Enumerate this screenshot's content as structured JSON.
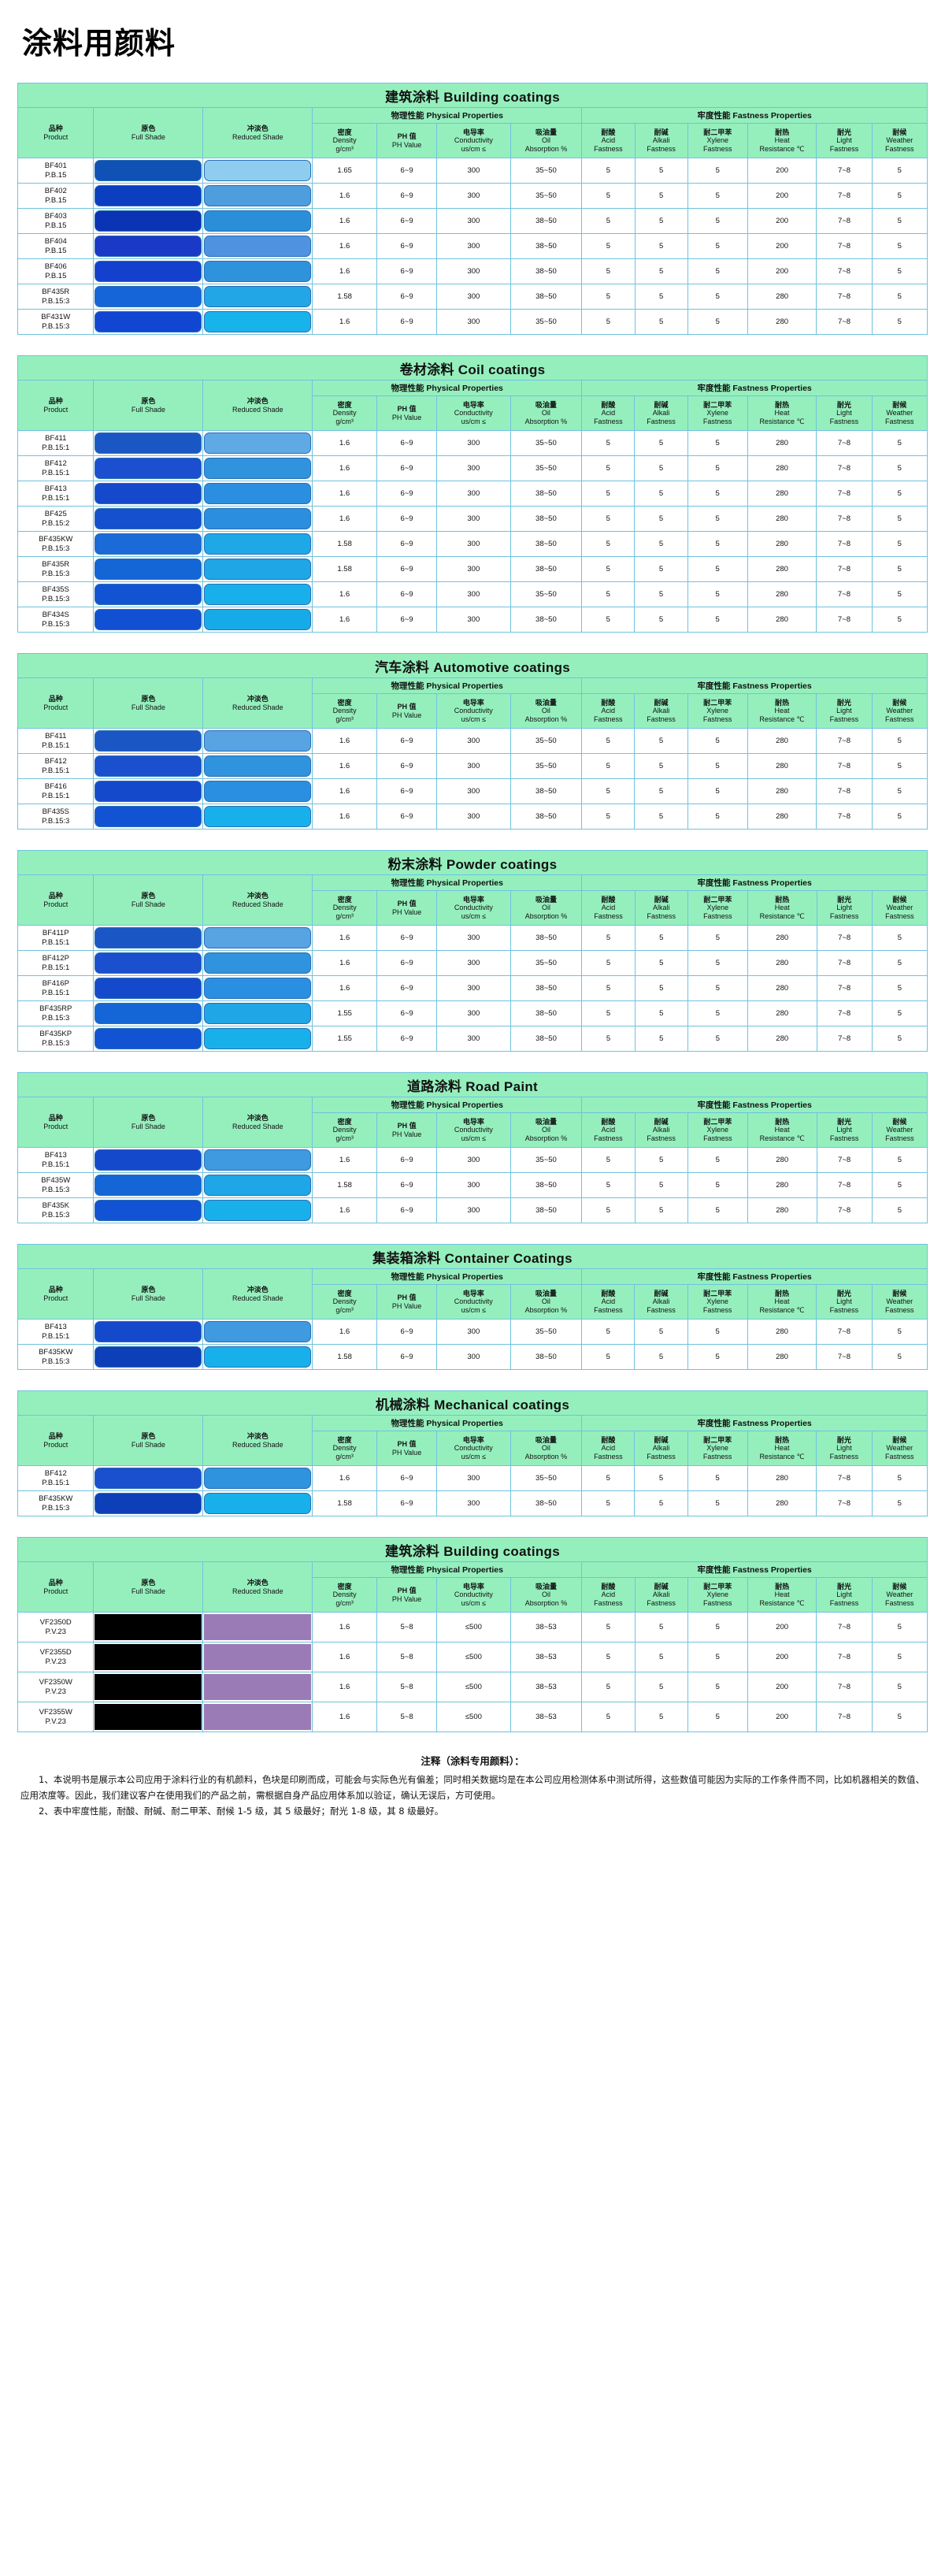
{
  "document": {
    "title": "涂料用颜料"
  },
  "columns": {
    "product": {
      "cn": "品种",
      "en": "Product"
    },
    "full_shade": {
      "cn": "原色",
      "en": "Full Shade"
    },
    "reduced_shade": {
      "cn": "冲淡色",
      "en": "Reduced Shade"
    },
    "physical_group": "物理性能 Physical Properties",
    "fastness_group": "牢度性能 Fastness Properties",
    "density": {
      "cn": "密度",
      "en": "Density",
      "unit": "g/cm³"
    },
    "ph": {
      "cn": "PH 值",
      "en": "PH Value"
    },
    "conductivity": {
      "cn": "电导率",
      "en": "Conductivity",
      "unit": "us/cm ≤"
    },
    "oil": {
      "cn": "吸油量",
      "en": "Oil",
      "unit": "Absorption %"
    },
    "acid": {
      "cn": "耐酸",
      "en": "Acid",
      "unit": "Fastness"
    },
    "alkali": {
      "cn": "耐碱",
      "en": "Alkali",
      "unit": "Fastness"
    },
    "xylene": {
      "cn": "耐二甲苯",
      "en": "Xylene",
      "unit": "Fastness"
    },
    "heat": {
      "cn": "耐热",
      "en": "Heat",
      "unit": "Resistance ℃"
    },
    "light": {
      "cn": "耐光",
      "en": "Light",
      "unit": "Fastness"
    },
    "weather": {
      "cn": "耐候",
      "en": "Weather",
      "unit": "Fastness"
    }
  },
  "colors": {
    "band": "#95efbd",
    "border": "#6fc2de",
    "outer_border": "#4aa8cf"
  },
  "tables": [
    {
      "title": "建筑涂料 Building coatings",
      "swatch_style": "round",
      "rows": [
        {
          "code": "BF401",
          "index": "P.B.15",
          "full": "#0f51b5",
          "reduced": "#8fcdf0",
          "density": "1.65",
          "ph": "6~9",
          "conductivity": "300",
          "oil": "35~50",
          "acid": "5",
          "alkali": "5",
          "xylene": "5",
          "heat": "200",
          "light": "7~8",
          "weather": "5"
        },
        {
          "code": "BF402",
          "index": "P.B.15",
          "full": "#0b3fc0",
          "reduced": "#4e9ddd",
          "density": "1.6",
          "ph": "6~9",
          "conductivity": "300",
          "oil": "35~50",
          "acid": "5",
          "alkali": "5",
          "xylene": "5",
          "heat": "200",
          "light": "7~8",
          "weather": "5"
        },
        {
          "code": "BF403",
          "index": "P.B.15",
          "full": "#0a34b4",
          "reduced": "#2a8fd8",
          "density": "1.6",
          "ph": "6~9",
          "conductivity": "300",
          "oil": "38~50",
          "acid": "5",
          "alkali": "5",
          "xylene": "5",
          "heat": "200",
          "light": "7~8",
          "weather": "5"
        },
        {
          "code": "BF404",
          "index": "P.B.15",
          "full": "#1939c6",
          "reduced": "#4f92e0",
          "density": "1.6",
          "ph": "6~9",
          "conductivity": "300",
          "oil": "38~50",
          "acid": "5",
          "alkali": "5",
          "xylene": "5",
          "heat": "200",
          "light": "7~8",
          "weather": "5"
        },
        {
          "code": "BF406",
          "index": "P.B.15",
          "full": "#1340cc",
          "reduced": "#2f92dd",
          "density": "1.6",
          "ph": "6~9",
          "conductivity": "300",
          "oil": "38~50",
          "acid": "5",
          "alkali": "5",
          "xylene": "5",
          "heat": "200",
          "light": "7~8",
          "weather": "5"
        },
        {
          "code": "BF435R",
          "index": "P.B.15:3",
          "full": "#1565d8",
          "reduced": "#22a6e6",
          "density": "1.58",
          "ph": "6~9",
          "conductivity": "300",
          "oil": "38~50",
          "acid": "5",
          "alkali": "5",
          "xylene": "5",
          "heat": "280",
          "light": "7~8",
          "weather": "5"
        },
        {
          "code": "BF431W",
          "index": "P.B.15:3",
          "full": "#1146d2",
          "reduced": "#18b3ea",
          "density": "1.6",
          "ph": "6~9",
          "conductivity": "300",
          "oil": "35~50",
          "acid": "5",
          "alkali": "5",
          "xylene": "5",
          "heat": "280",
          "light": "7~8",
          "weather": "5"
        }
      ]
    },
    {
      "title": "卷材涂料 Coil coatings",
      "swatch_style": "round",
      "rows": [
        {
          "code": "BF411",
          "index": "P.B.15:1",
          "full": "#1b57c4",
          "reduced": "#5fa9e4",
          "density": "1.6",
          "ph": "6~9",
          "conductivity": "300",
          "oil": "35~50",
          "acid": "5",
          "alkali": "5",
          "xylene": "5",
          "heat": "280",
          "light": "7~8",
          "weather": "5"
        },
        {
          "code": "BF412",
          "index": "P.B.15:1",
          "full": "#1b4fd0",
          "reduced": "#2f93dd",
          "density": "1.6",
          "ph": "6~9",
          "conductivity": "300",
          "oil": "35~50",
          "acid": "5",
          "alkali": "5",
          "xylene": "5",
          "heat": "280",
          "light": "7~8",
          "weather": "5"
        },
        {
          "code": "BF413",
          "index": "P.B.15:1",
          "full": "#1549cc",
          "reduced": "#2a8fe0",
          "density": "1.6",
          "ph": "6~9",
          "conductivity": "300",
          "oil": "38~50",
          "acid": "5",
          "alkali": "5",
          "xylene": "5",
          "heat": "280",
          "light": "7~8",
          "weather": "5"
        },
        {
          "code": "BF425",
          "index": "P.B.15:2",
          "full": "#1550cf",
          "reduced": "#2b8ede",
          "density": "1.6",
          "ph": "6~9",
          "conductivity": "300",
          "oil": "38~50",
          "acid": "5",
          "alkali": "5",
          "xylene": "5",
          "heat": "280",
          "light": "7~8",
          "weather": "5"
        },
        {
          "code": "BF435KW",
          "index": "P.B.15:3",
          "full": "#1a6ad8",
          "reduced": "#1fa8e8",
          "density": "1.58",
          "ph": "6~9",
          "conductivity": "300",
          "oil": "38~50",
          "acid": "5",
          "alkali": "5",
          "xylene": "5",
          "heat": "280",
          "light": "7~8",
          "weather": "5"
        },
        {
          "code": "BF435R",
          "index": "P.B.15:3",
          "full": "#1466d6",
          "reduced": "#1ea6e6",
          "density": "1.58",
          "ph": "6~9",
          "conductivity": "300",
          "oil": "38~50",
          "acid": "5",
          "alkali": "5",
          "xylene": "5",
          "heat": "280",
          "light": "7~8",
          "weather": "5"
        },
        {
          "code": "BF435S",
          "index": "P.B.15:3",
          "full": "#1253d4",
          "reduced": "#18b0ea",
          "density": "1.6",
          "ph": "6~9",
          "conductivity": "300",
          "oil": "35~50",
          "acid": "5",
          "alkali": "5",
          "xylene": "5",
          "heat": "280",
          "light": "7~8",
          "weather": "5"
        },
        {
          "code": "BF434S",
          "index": "P.B.15:3",
          "full": "#1150d2",
          "reduced": "#16abe8",
          "density": "1.6",
          "ph": "6~9",
          "conductivity": "300",
          "oil": "38~50",
          "acid": "5",
          "alkali": "5",
          "xylene": "5",
          "heat": "280",
          "light": "7~8",
          "weather": "5"
        }
      ]
    },
    {
      "title": "汽车涂料 Automotive coatings",
      "swatch_style": "round",
      "rows": [
        {
          "code": "BF411",
          "index": "P.B.15:1",
          "full": "#1b57c4",
          "reduced": "#58a4e2",
          "density": "1.6",
          "ph": "6~9",
          "conductivity": "300",
          "oil": "35~50",
          "acid": "5",
          "alkali": "5",
          "xylene": "5",
          "heat": "280",
          "light": "7~8",
          "weather": "5"
        },
        {
          "code": "BF412",
          "index": "P.B.15:1",
          "full": "#1a4fcd",
          "reduced": "#2f93dd",
          "density": "1.6",
          "ph": "6~9",
          "conductivity": "300",
          "oil": "35~50",
          "acid": "5",
          "alkali": "5",
          "xylene": "5",
          "heat": "280",
          "light": "7~8",
          "weather": "5"
        },
        {
          "code": "BF416",
          "index": "P.B.15:1",
          "full": "#1549cc",
          "reduced": "#2a8fe0",
          "density": "1.6",
          "ph": "6~9",
          "conductivity": "300",
          "oil": "38~50",
          "acid": "5",
          "alkali": "5",
          "xylene": "5",
          "heat": "280",
          "light": "7~8",
          "weather": "5"
        },
        {
          "code": "BF435S",
          "index": "P.B.15:3",
          "full": "#1253d4",
          "reduced": "#18b0ea",
          "density": "1.6",
          "ph": "6~9",
          "conductivity": "300",
          "oil": "38~50",
          "acid": "5",
          "alkali": "5",
          "xylene": "5",
          "heat": "280",
          "light": "7~8",
          "weather": "5"
        }
      ]
    },
    {
      "title": "粉末涂料 Powder coatings",
      "swatch_style": "round",
      "rows": [
        {
          "code": "BF411P",
          "index": "P.B.15:1",
          "full": "#1b57c4",
          "reduced": "#58a4e2",
          "density": "1.6",
          "ph": "6~9",
          "conductivity": "300",
          "oil": "38~50",
          "acid": "5",
          "alkali": "5",
          "xylene": "5",
          "heat": "280",
          "light": "7~8",
          "weather": "5"
        },
        {
          "code": "BF412P",
          "index": "P.B.15:1",
          "full": "#1a4fcd",
          "reduced": "#2f93dd",
          "density": "1.6",
          "ph": "6~9",
          "conductivity": "300",
          "oil": "35~50",
          "acid": "5",
          "alkali": "5",
          "xylene": "5",
          "heat": "280",
          "light": "7~8",
          "weather": "5"
        },
        {
          "code": "BF416P",
          "index": "P.B.15:1",
          "full": "#1549cc",
          "reduced": "#2a8fe0",
          "density": "1.6",
          "ph": "6~9",
          "conductivity": "300",
          "oil": "38~50",
          "acid": "5",
          "alkali": "5",
          "xylene": "5",
          "heat": "280",
          "light": "7~8",
          "weather": "5"
        },
        {
          "code": "BF435RP",
          "index": "P.B.15:3",
          "full": "#1466d6",
          "reduced": "#1ea6e6",
          "density": "1.55",
          "ph": "6~9",
          "conductivity": "300",
          "oil": "38~50",
          "acid": "5",
          "alkali": "5",
          "xylene": "5",
          "heat": "280",
          "light": "7~8",
          "weather": "5"
        },
        {
          "code": "BF435KP",
          "index": "P.B.15:3",
          "full": "#1253d4",
          "reduced": "#18b0ea",
          "density": "1.55",
          "ph": "6~9",
          "conductivity": "300",
          "oil": "38~50",
          "acid": "5",
          "alkali": "5",
          "xylene": "5",
          "heat": "280",
          "light": "7~8",
          "weather": "5"
        }
      ]
    },
    {
      "title": "道路涂料 Road Paint",
      "swatch_style": "round",
      "rows": [
        {
          "code": "BF413",
          "index": "P.B.15:1",
          "full": "#1549cc",
          "reduced": "#3f9ae0",
          "density": "1.6",
          "ph": "6~9",
          "conductivity": "300",
          "oil": "35~50",
          "acid": "5",
          "alkali": "5",
          "xylene": "5",
          "heat": "280",
          "light": "7~8",
          "weather": "5"
        },
        {
          "code": "BF435W",
          "index": "P.B.15:3",
          "full": "#1466d6",
          "reduced": "#1ea6e6",
          "density": "1.58",
          "ph": "6~9",
          "conductivity": "300",
          "oil": "38~50",
          "acid": "5",
          "alkali": "5",
          "xylene": "5",
          "heat": "280",
          "light": "7~8",
          "weather": "5"
        },
        {
          "code": "BF435K",
          "index": "P.B.15:3",
          "full": "#1253d4",
          "reduced": "#18b0ea",
          "density": "1.6",
          "ph": "6~9",
          "conductivity": "300",
          "oil": "38~50",
          "acid": "5",
          "alkali": "5",
          "xylene": "5",
          "heat": "280",
          "light": "7~8",
          "weather": "5"
        }
      ]
    },
    {
      "title": "集装箱涂料 Container Coatings",
      "swatch_style": "round",
      "rows": [
        {
          "code": "BF413",
          "index": "P.B.15:1",
          "full": "#1549cc",
          "reduced": "#3f9ae0",
          "density": "1.6",
          "ph": "6~9",
          "conductivity": "300",
          "oil": "35~50",
          "acid": "5",
          "alkali": "5",
          "xylene": "5",
          "heat": "280",
          "light": "7~8",
          "weather": "5"
        },
        {
          "code": "BF435KW",
          "index": "P.B.15:3",
          "full": "#0d3fb8",
          "reduced": "#18b0ea",
          "density": "1.58",
          "ph": "6~9",
          "conductivity": "300",
          "oil": "38~50",
          "acid": "5",
          "alkali": "5",
          "xylene": "5",
          "heat": "280",
          "light": "7~8",
          "weather": "5"
        }
      ]
    },
    {
      "title": "机械涂料 Mechanical coatings",
      "swatch_style": "round",
      "rows": [
        {
          "code": "BF412",
          "index": "P.B.15:1",
          "full": "#1a4fcd",
          "reduced": "#2f93dd",
          "density": "1.6",
          "ph": "6~9",
          "conductivity": "300",
          "oil": "35~50",
          "acid": "5",
          "alkali": "5",
          "xylene": "5",
          "heat": "280",
          "light": "7~8",
          "weather": "5"
        },
        {
          "code": "BF435KW",
          "index": "P.B.15:3",
          "full": "#0d3fb8",
          "reduced": "#18b0ea",
          "density": "1.58",
          "ph": "6~9",
          "conductivity": "300",
          "oil": "38~50",
          "acid": "5",
          "alkali": "5",
          "xylene": "5",
          "heat": "280",
          "light": "7~8",
          "weather": "5"
        }
      ]
    },
    {
      "title": "建筑涂料 Building coatings",
      "swatch_style": "square",
      "rows": [
        {
          "code": "VF2350D",
          "index": "P.V.23",
          "full": "#000000",
          "reduced": "#9b7bb5",
          "density": "1.6",
          "ph": "5~8",
          "conductivity": "≤500",
          "oil": "38~53",
          "acid": "5",
          "alkali": "5",
          "xylene": "5",
          "heat": "200",
          "light": "7~8",
          "weather": "5"
        },
        {
          "code": "VF2355D",
          "index": "P.V.23",
          "full": "#000000",
          "reduced": "#9b7bb5",
          "density": "1.6",
          "ph": "5~8",
          "conductivity": "≤500",
          "oil": "38~53",
          "acid": "5",
          "alkali": "5",
          "xylene": "5",
          "heat": "200",
          "light": "7~8",
          "weather": "5"
        },
        {
          "code": "VF2350W",
          "index": "P.V.23",
          "full": "#000000",
          "reduced": "#9b7bb5",
          "density": "1.6",
          "ph": "5~8",
          "conductivity": "≤500",
          "oil": "38~53",
          "acid": "5",
          "alkali": "5",
          "xylene": "5",
          "heat": "200",
          "light": "7~8",
          "weather": "5"
        },
        {
          "code": "VF2355W",
          "index": "P.V.23",
          "full": "#000000",
          "reduced": "#9b7bb5",
          "density": "1.6",
          "ph": "5~8",
          "conductivity": "≤500",
          "oil": "38~53",
          "acid": "5",
          "alkali": "5",
          "xylene": "5",
          "heat": "200",
          "light": "7~8",
          "weather": "5"
        }
      ]
    }
  ],
  "notes": {
    "heading": "注释（涂料专用颜料）：",
    "line1": "1、本说明书是展示本公司应用于涂料行业的有机颜料，色块是印刷而成，可能会与实际色光有偏差；同时相关数据均是在本公司应用检测体系中测试所得，这些数值可能因为实际的工作条件而不同，比如机器相关的数值、应用浓度等。因此，我们建议客户在使用我们的产品之前，需根据自身产品应用体系加以验证，确认无误后，方可使用。",
    "line2": "2、表中牢度性能，耐酸、耐碱、耐二甲苯、耐候 1-5 级，其 5 级最好；耐光 1-8 级，其 8 级最好。"
  }
}
